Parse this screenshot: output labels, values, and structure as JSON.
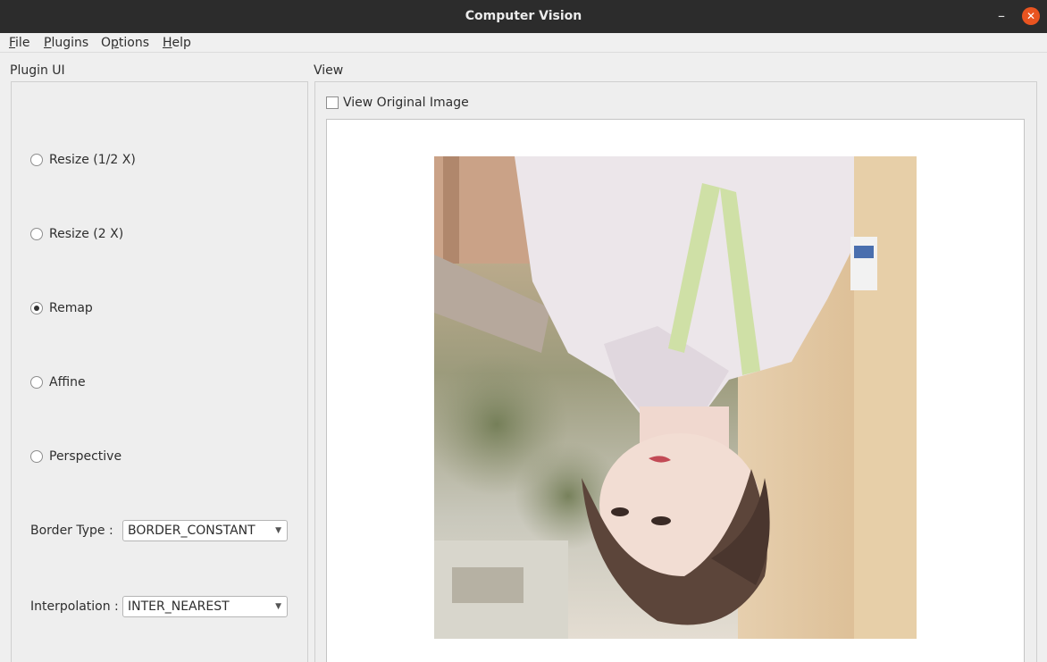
{
  "window": {
    "title": "Computer Vision",
    "minimize_glyph": "–",
    "close_glyph": "✕"
  },
  "menubar": {
    "items": [
      {
        "mnemonic": "F",
        "rest": "ile"
      },
      {
        "mnemonic": "P",
        "rest": "lugins"
      },
      {
        "before": "O",
        "mnemonic": "p",
        "rest": "tions"
      },
      {
        "mnemonic": "H",
        "rest": "elp"
      }
    ]
  },
  "plugin_ui": {
    "title": "Plugin UI",
    "options": [
      {
        "label": "Resize (1/2 X)",
        "checked": false
      },
      {
        "label": "Resize (2 X)",
        "checked": false
      },
      {
        "label": "Remap",
        "checked": true
      },
      {
        "label": "Affine",
        "checked": false
      },
      {
        "label": "Perspective",
        "checked": false
      }
    ],
    "border_type": {
      "label": "Border Type :",
      "value": "BORDER_CONSTANT"
    },
    "interpolation": {
      "label": "Interpolation :",
      "value": "INTER_NEAREST"
    },
    "combo_arrow_icon": "triangle-down-icon"
  },
  "view": {
    "title": "View",
    "view_original_label": "View Original Image",
    "view_original_checked": false
  },
  "colors": {
    "titlebar": "#2c2c2c",
    "close_button": "#e95420",
    "window_bg": "#efefef"
  }
}
